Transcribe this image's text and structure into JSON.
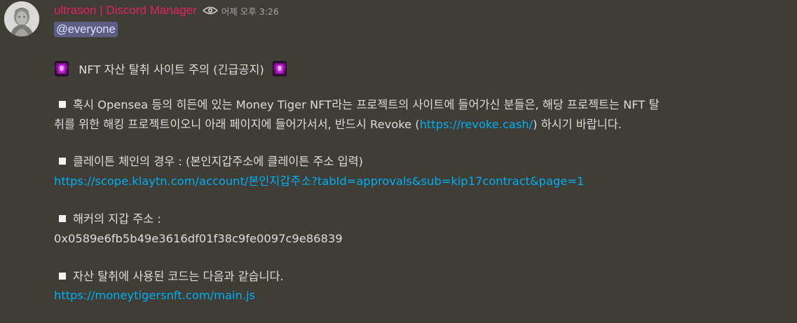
{
  "author": {
    "name": "ultrason | Discord Manager",
    "name_color": "#e0245e",
    "badge_icon": "eye-icon",
    "timestamp": "어제 오후 3:26"
  },
  "message": {
    "mention": "@everyone",
    "title_icon": "purple-gem-icon",
    "title": "NFT 자산 탈취 사이트 주의 (긴급공지)",
    "bullet_icon": "white-square-icon",
    "p1_line1": "혹시 Opensea 등의 히든에 있는 Money Tiger NFT라는 프로젝트의 사이트에 들어가신 분들은, 해당 프로젝트는 NFT 탈",
    "p1_line2_before": "취를 위한 해킹 프로젝트이오니 아래 페이지에 들어가서서, 반드시 Revoke (",
    "p1_link": "https://revoke.cash/",
    "p1_line2_after": ") 하시기 바랍니다.",
    "p2_heading": "클레이튼 체인의 경우 : (본인지갑주소에 클레이튼 주소 입력)",
    "p2_link": "https://scope.klaytn.com/account/본인지갑주소?tabId=approvals&sub=kip17contract&page=1",
    "p3_heading": "해커의 지갑 주소 :",
    "p3_address": "0x0589e6fb5b49e3616df01f38c9fe0097c9e86839",
    "p4_heading": "자산 탈취에 사용된 코드는 다음과 같습니다.",
    "p4_link": "https://moneytigersnft.com/main.js"
  },
  "colors": {
    "background": "#3f3d36",
    "text": "#dcddde",
    "link": "#00aff4",
    "mention_bg": "#5c5e83",
    "timestamp": "#a3a6aa"
  }
}
